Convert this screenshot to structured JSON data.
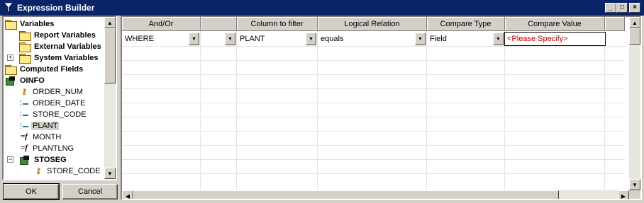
{
  "window": {
    "title": "Expression Builder",
    "controls": {
      "minimize": "_",
      "maximize": "□",
      "close": "×"
    }
  },
  "tree": {
    "items": [
      {
        "label": "Variables",
        "icon": "folder-icon",
        "bold": true
      },
      {
        "label": "Report Variables",
        "icon": "folder-icon",
        "bold": true
      },
      {
        "label": "External Variables",
        "icon": "folder-icon",
        "bold": true
      },
      {
        "label": "System Variables",
        "icon": "folder-icon",
        "bold": true,
        "expander": "+"
      },
      {
        "label": "Computed Fields",
        "icon": "folder-icon",
        "bold": true
      },
      {
        "label": "OINFO",
        "icon": "database-icon",
        "bold": true
      },
      {
        "label": "ORDER_NUM",
        "icon": "key-icon"
      },
      {
        "label": "ORDER_DATE",
        "icon": "field-icon"
      },
      {
        "label": "STORE_CODE",
        "icon": "field-icon"
      },
      {
        "label": "PLANT",
        "icon": "field-icon",
        "selected": true
      },
      {
        "label": "MONTH",
        "icon": "function-icon"
      },
      {
        "label": "PLANTLNG",
        "icon": "function-icon"
      },
      {
        "label": "STOSEG",
        "icon": "database-icon",
        "bold": true,
        "expander": "−"
      },
      {
        "label": "STORE_CODE",
        "icon": "key-icon"
      }
    ]
  },
  "buttons": {
    "ok": "OK",
    "cancel": "Cancel"
  },
  "grid": {
    "columns": [
      "And/Or",
      "",
      "Column to filter",
      "Logical Relation",
      "Compare Type",
      "Compare Value"
    ],
    "row": {
      "and_or": "WHERE",
      "paren": "",
      "column": "PLANT",
      "relation": "equals",
      "compare_type": "Field",
      "compare_value": "<Please Specify>"
    }
  },
  "colors": {
    "title_bar": "#0a246a",
    "window_bg": "#d4d0c8",
    "placeholder_text": "#c00000"
  }
}
